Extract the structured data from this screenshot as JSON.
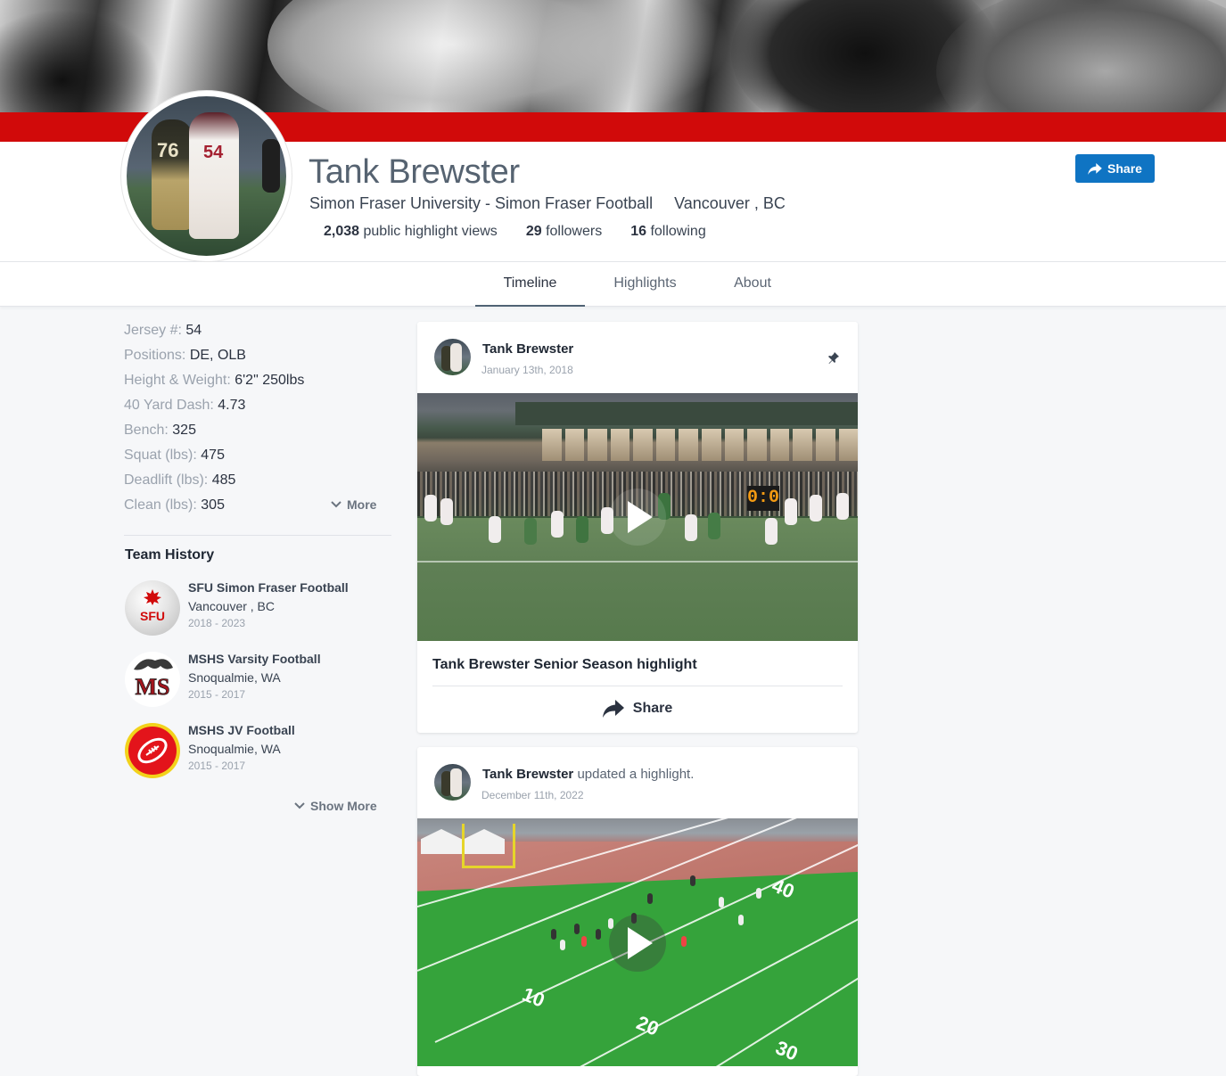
{
  "profile": {
    "name": "Tank Brewster",
    "school": "Simon Fraser University - Simon Fraser Football",
    "location": "Vancouver , BC",
    "stats": {
      "views_count": "2,038",
      "views_label": "public highlight views",
      "followers_count": "29",
      "followers_label": "followers",
      "following_count": "16",
      "following_label": "following"
    },
    "share_label": "Share",
    "avatar_numbers": [
      "76",
      "54"
    ]
  },
  "tabs": [
    {
      "label": "Timeline",
      "active": true
    },
    {
      "label": "Highlights",
      "active": false
    },
    {
      "label": "About",
      "active": false
    }
  ],
  "facts": [
    {
      "label": "Jersey #:",
      "value": "54"
    },
    {
      "label": "Positions:",
      "value": "DE, OLB"
    },
    {
      "label": "Height & Weight:",
      "value": "6'2\" 250lbs"
    },
    {
      "label": "40 Yard Dash:",
      "value": "4.73"
    },
    {
      "label": "Bench:",
      "value": "325"
    },
    {
      "label": "Squat (lbs):",
      "value": "475"
    },
    {
      "label": "Deadlift (lbs):",
      "value": "485"
    },
    {
      "label": "Clean (lbs):",
      "value": "305"
    }
  ],
  "more_label": "More",
  "team_history": {
    "title": "Team History",
    "teams": [
      {
        "name": "SFU Simon Fraser Football",
        "location": "Vancouver , BC",
        "years": "2018 - 2023",
        "logo_text": "SFU"
      },
      {
        "name": "MSHS Varsity Football",
        "location": "Snoqualmie, WA",
        "years": "2015 - 2017",
        "logo_text": "MS"
      },
      {
        "name": "MSHS JV Football",
        "location": "Snoqualmie, WA",
        "years": "2015 - 2017",
        "logo_text": ""
      }
    ],
    "show_more_label": "Show More"
  },
  "feed": [
    {
      "author": "Tank Brewster",
      "action": "",
      "date": "January 13th, 2018",
      "pinned": true,
      "title": "Tank Brewster Senior Season highlight",
      "share_label": "Share",
      "scoreboard": "0:0"
    },
    {
      "author": "Tank Brewster",
      "action": "updated a highlight.",
      "date": "December 11th, 2022",
      "pinned": false,
      "yard_numbers": [
        "40",
        "10",
        "20",
        "30"
      ]
    }
  ],
  "colors": {
    "brand_red": "#d10a0a",
    "share_blue": "#0f74c3"
  }
}
